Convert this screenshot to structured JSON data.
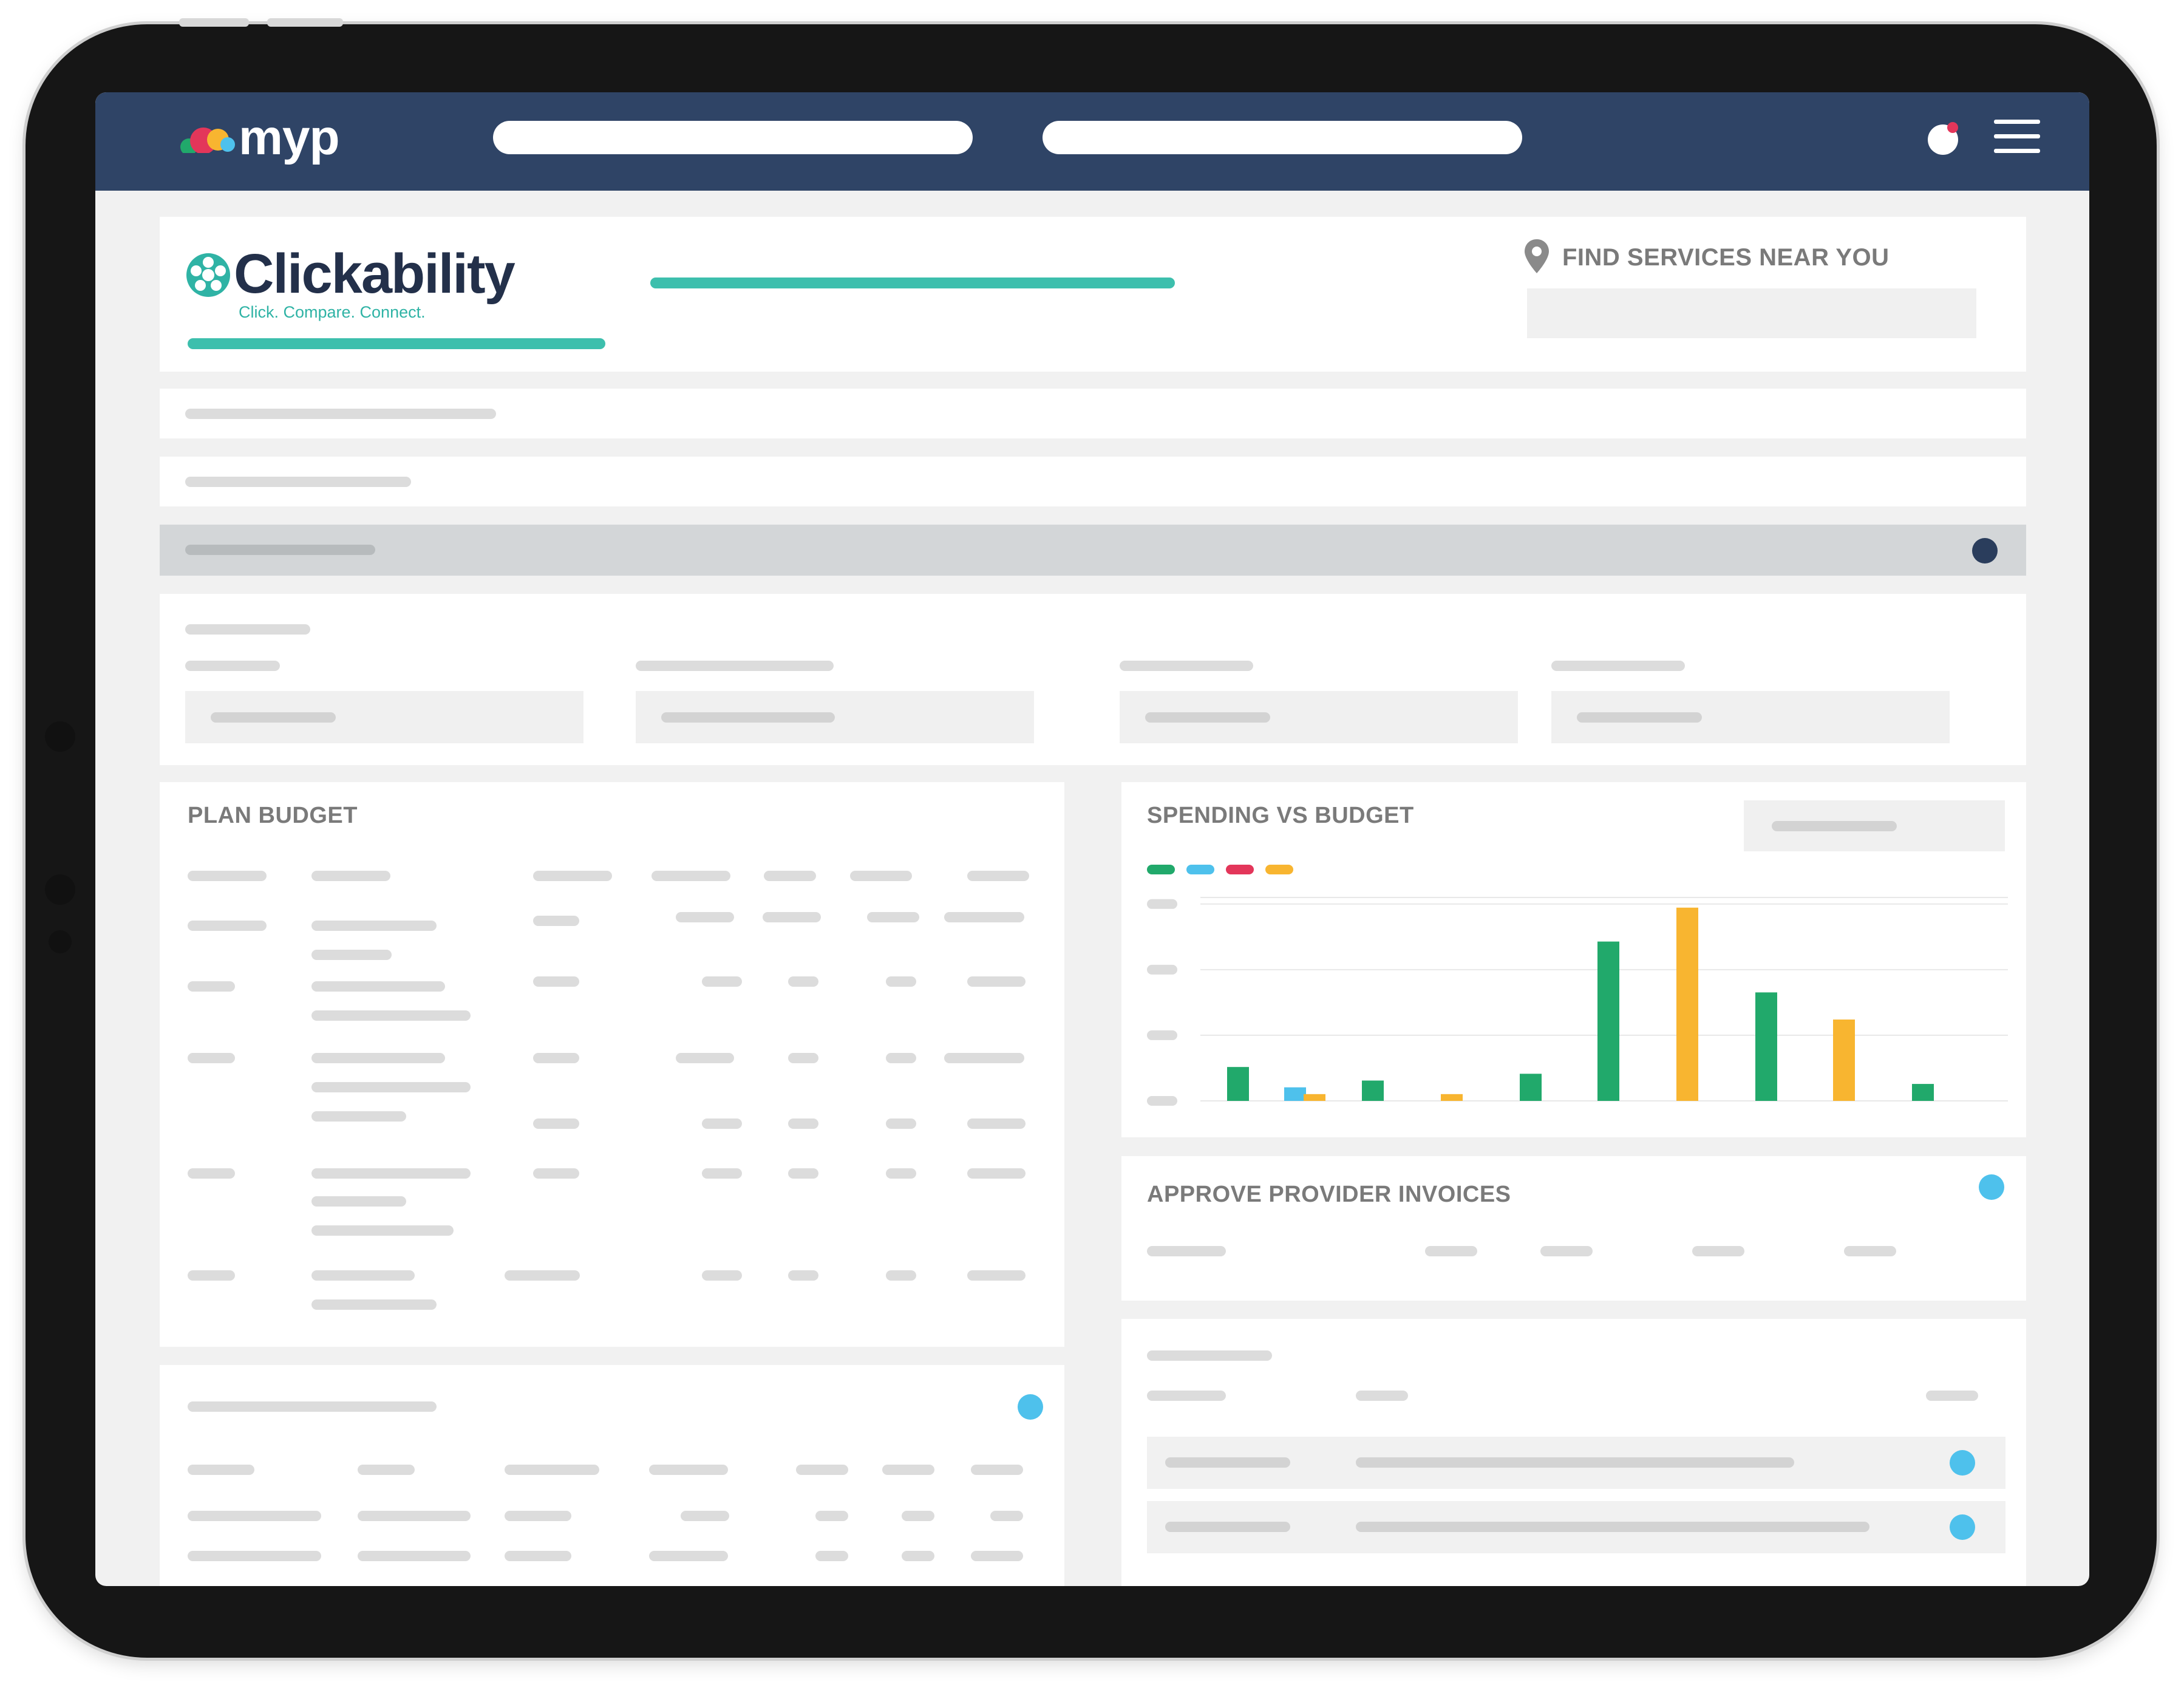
{
  "app": {
    "logo_text": "myp",
    "brand": {
      "name": "Clickability",
      "tagline": "Click. Compare. Connect."
    },
    "find_services_label": "FIND SERVICES NEAR YOU"
  },
  "panels": {
    "plan_budget_title": "PLAN BUDGET",
    "spending_vs_budget_title": "SPENDING VS BUDGET",
    "approve_invoices_title": "APPROVE PROVIDER INVOICES"
  },
  "icons": {
    "location": "map-pin-icon",
    "menu": "hamburger-menu-icon",
    "profile": "user-avatar-icon"
  },
  "colors": {
    "nav_bg": "#2f4466",
    "accent_teal": "#3dbfad",
    "bar_green": "#21a96b",
    "bar_blue": "#4ec1ec",
    "bar_red": "#e3365a",
    "bar_orange": "#f8b530",
    "status_blue": "#4ec1ec"
  },
  "chart_data": {
    "type": "bar",
    "title": "SPENDING VS BUDGET",
    "legend_colors": [
      "#21a96b",
      "#4ec1ec",
      "#e3365a",
      "#f8b530"
    ],
    "grid": true,
    "bars": [
      {
        "color": "#21a96b",
        "value": 10
      },
      {
        "color": "#4ec1ec",
        "value": 4
      },
      {
        "color": "#f8b530",
        "value": 2
      },
      {
        "color": "#21a96b",
        "value": 6
      },
      {
        "color": "#f8b530",
        "value": 2
      },
      {
        "color": "#21a96b",
        "value": 8
      },
      {
        "color": "#21a96b",
        "value": 47
      },
      {
        "color": "#f8b530",
        "value": 57
      },
      {
        "color": "#21a96b",
        "value": 32
      },
      {
        "color": "#f8b530",
        "value": 24
      },
      {
        "color": "#21a96b",
        "value": 5
      }
    ],
    "ylim": [
      0,
      60
    ]
  }
}
